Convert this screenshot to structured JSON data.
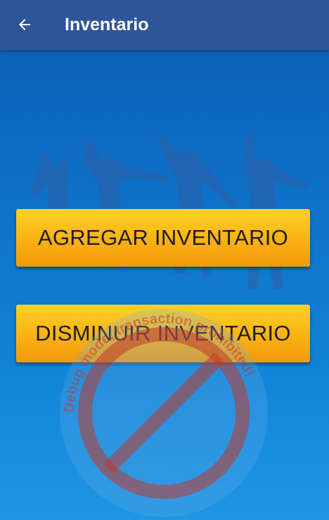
{
  "appbar": {
    "title": "Inventario",
    "back_icon": "arrow-left-icon"
  },
  "actions": {
    "add_inventory_label": "AGREGAR INVENTARIO",
    "decrease_inventory_label": "DISMINUIR INVENTARIO"
  },
  "watermark": {
    "text": "Debug mode, transaction prohibited!"
  },
  "colors": {
    "appbar": "#2e5598",
    "background_top": "#0b5fb2",
    "background_bottom": "#1e96e3",
    "button_gradient_top": "#ffd12c",
    "button_gradient_bottom": "#f39a0b",
    "button_text": "#1d1d1d",
    "stamp_red": "#c0392b"
  }
}
